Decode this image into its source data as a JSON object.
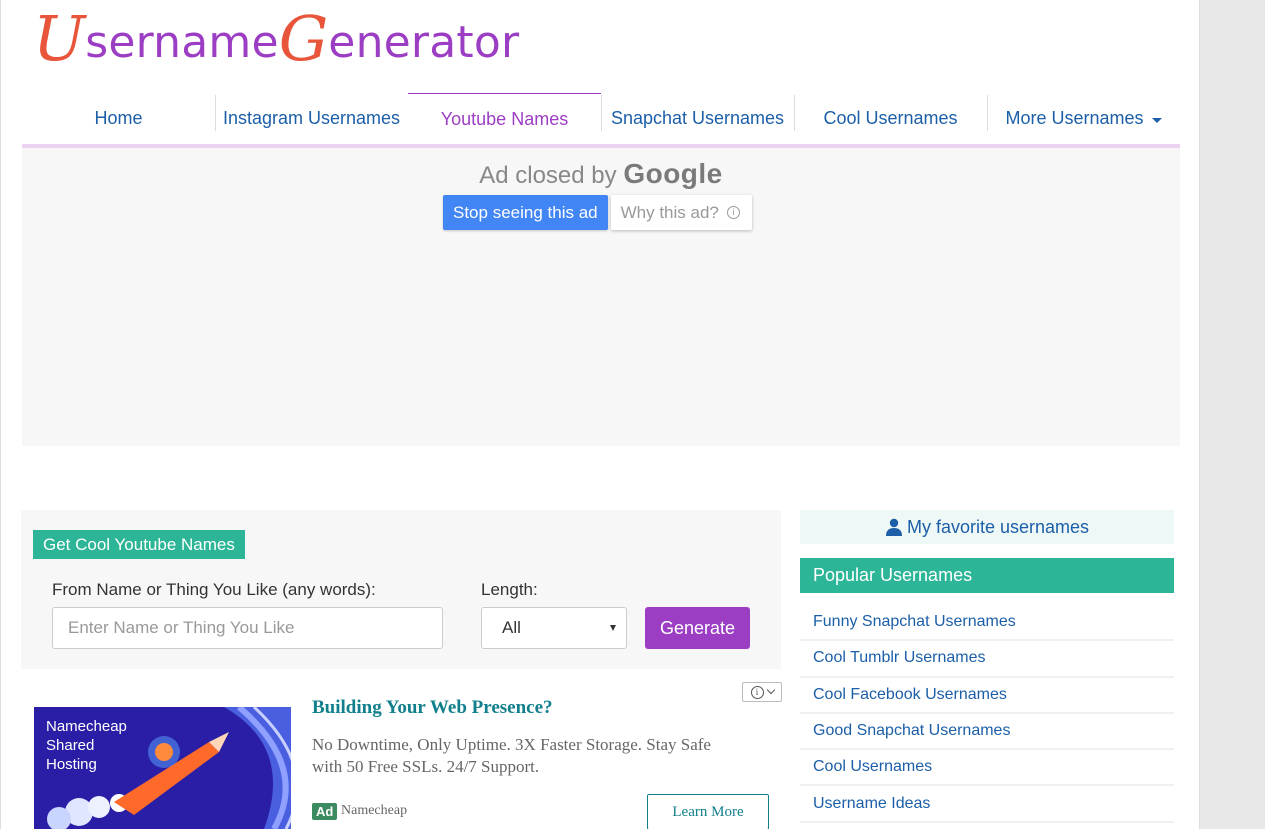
{
  "logo": {
    "cap1": "U",
    "word1": "sername",
    "cap2": "G",
    "word2": "enerator"
  },
  "nav": {
    "items": [
      {
        "label": "Home"
      },
      {
        "label": "Instagram Usernames"
      },
      {
        "label": "Youtube Names"
      },
      {
        "label": "Snapchat Usernames"
      },
      {
        "label": "Cool Usernames"
      },
      {
        "label": "More Usernames"
      }
    ],
    "active": "Youtube Names"
  },
  "ad_closed": {
    "prefix": "Ad closed by",
    "brand": "Google",
    "stop_label": "Stop seeing this ad",
    "why_label": "Why this ad?",
    "info_glyph": "i"
  },
  "generator": {
    "title": "Get Cool Youtube Names",
    "name_label": "From Name or Thing You Like (any words):",
    "name_placeholder": "Enter Name or Thing You Like",
    "length_label": "Length:",
    "length_value": "All",
    "button_label": "Generate"
  },
  "ad": {
    "image_text": [
      "Namecheap",
      "Shared",
      "Hosting"
    ],
    "headline": "Building Your Web Presence?",
    "body": "No Downtime, Only Uptime. 3X Faster Storage. Stay Safe with 50 Free SSLs. 24/7 Support.",
    "badge": "Ad",
    "source": "Namecheap",
    "cta": "Learn More",
    "choices_glyph": "i"
  },
  "sidebar": {
    "favorites_label": "My favorite usernames",
    "popular_title": "Popular Usernames",
    "popular_items": [
      "Funny Snapchat Usernames",
      "Cool Tumblr Usernames",
      "Cool Facebook Usernames",
      "Good Snapchat Usernames",
      "Cool Usernames",
      "Username Ideas"
    ]
  },
  "colors": {
    "purple": "#9c3ec4",
    "orange": "#e8553a",
    "teal": "#2cb596",
    "link": "#1c5fa8",
    "google_blue": "#4285f4"
  }
}
